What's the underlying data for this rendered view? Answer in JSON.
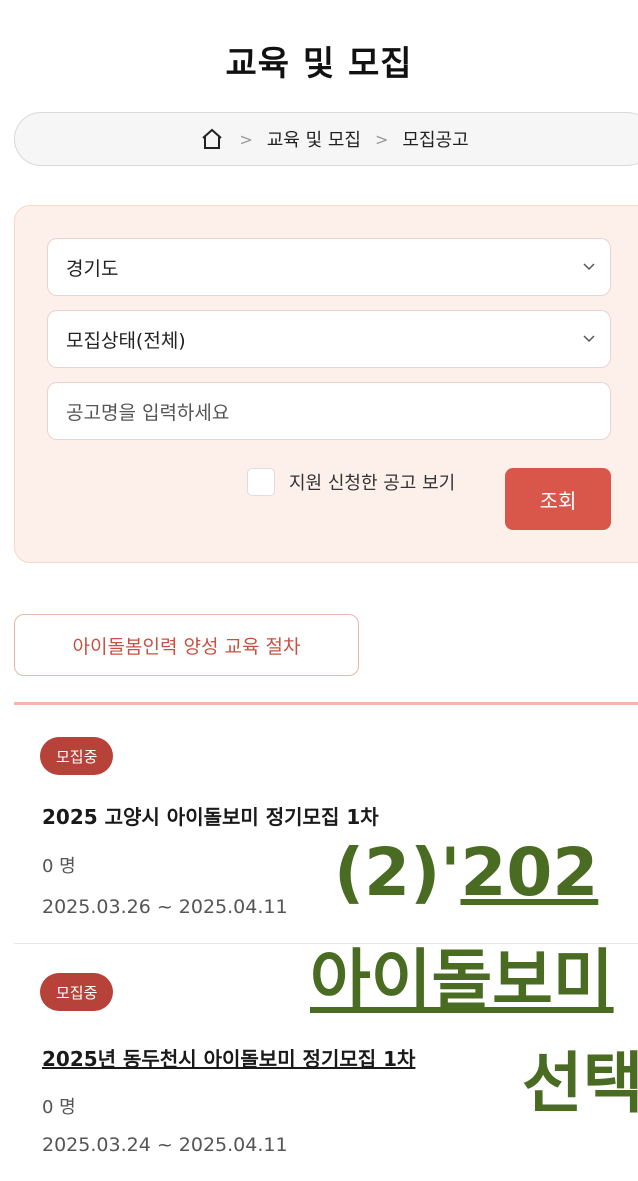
{
  "page_title": "교육 및 모집",
  "breadcrumb": {
    "level1": "교육 및 모집",
    "level2": "모집공고",
    "separator": ">"
  },
  "filters": {
    "region": "경기도",
    "status": "모집상태(전체)",
    "search_placeholder": "공고명을 입력하세요",
    "applied_only_label": "지원 신청한 공고 보기",
    "search_button": "조회"
  },
  "process_button": "아이돌봄인력 양성 교육 절차",
  "listings": [
    {
      "badge": "모집중",
      "title": "2025 고양시 아이돌보미 정기모집 1차",
      "count": "0 명",
      "period": "2025.03.26 ~ 2025.04.11"
    },
    {
      "badge": "모집중",
      "title": "2025년 동두천시 아이돌보미 정기모집 1차",
      "count": "0 명",
      "period": "2025.03.24 ~ 2025.04.11"
    }
  ],
  "overlay": {
    "line1_prefix": "(2)'",
    "line1_rest": "202",
    "line2": "아이돌보미",
    "line3": "선택"
  },
  "colors": {
    "accent": "#d9574a",
    "badge": "#b6423a",
    "overlay": "#4a6b22"
  }
}
